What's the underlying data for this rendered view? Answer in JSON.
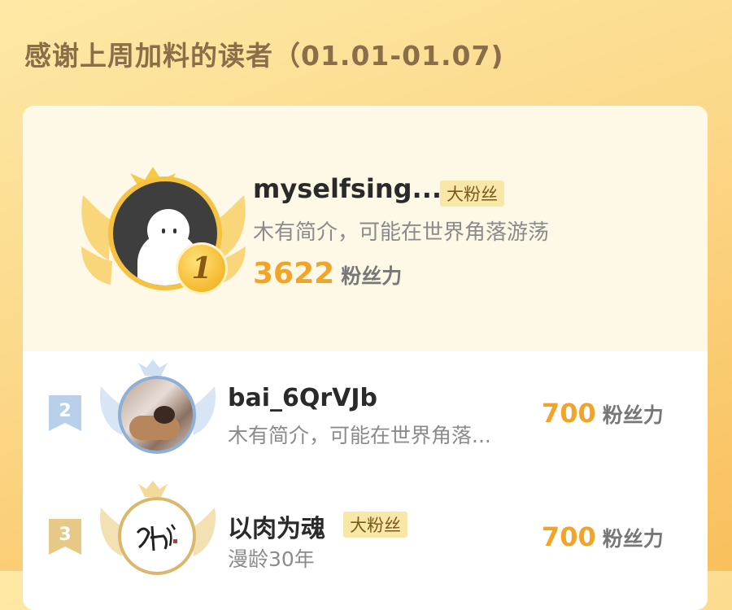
{
  "header": {
    "title": "感谢上周加料的读者（01.01-01.07)"
  },
  "ranking": {
    "first": {
      "rank": "1",
      "name": "myselfsing...",
      "badge": "大粉丝",
      "bio": "木有简介，可能在世界角落游荡",
      "score": "3622",
      "unit": "粉丝力"
    },
    "rows": [
      {
        "rank": "2",
        "name": "bai_6QrVJb",
        "bio": "木有简介，可能在世界角落...",
        "score": "700",
        "unit": "粉丝力"
      },
      {
        "rank": "3",
        "name": "以肉为魂",
        "badge": "大粉丝",
        "bio": "漫龄30年",
        "score": "700",
        "unit": "粉丝力"
      }
    ]
  },
  "colors": {
    "accent": "#f1a428",
    "gold": "#f5c242",
    "silver": "#a9c4e0"
  }
}
